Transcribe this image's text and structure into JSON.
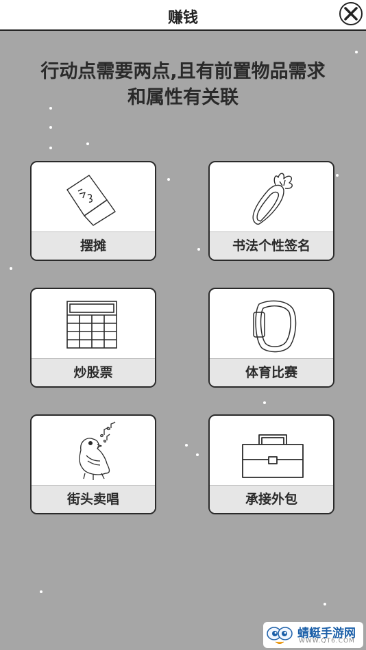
{
  "header": {
    "title": "赚钱",
    "close_icon": "close-icon"
  },
  "notice": {
    "line1": "行动点需要两点,且有前置物品需求",
    "line2": "和属性有关联"
  },
  "options": [
    {
      "label": "摆摊",
      "icon": "sign-card-icon"
    },
    {
      "label": "书法个性签名",
      "icon": "carrot-icon"
    },
    {
      "label": "炒股票",
      "icon": "calculator-grid-icon"
    },
    {
      "label": "体育比赛",
      "icon": "wristband-icon"
    },
    {
      "label": "街头卖唱",
      "icon": "singing-bird-icon"
    },
    {
      "label": "承接外包",
      "icon": "briefcase-icon"
    }
  ],
  "watermark": {
    "text": "蜻蜓手游网",
    "url": "WWW.QT6.COM"
  },
  "colors": {
    "background": "#a6a6a6",
    "card": "#ffffff",
    "label_bar": "#e6e6e6",
    "watermark_text": "#1b5fa8"
  }
}
